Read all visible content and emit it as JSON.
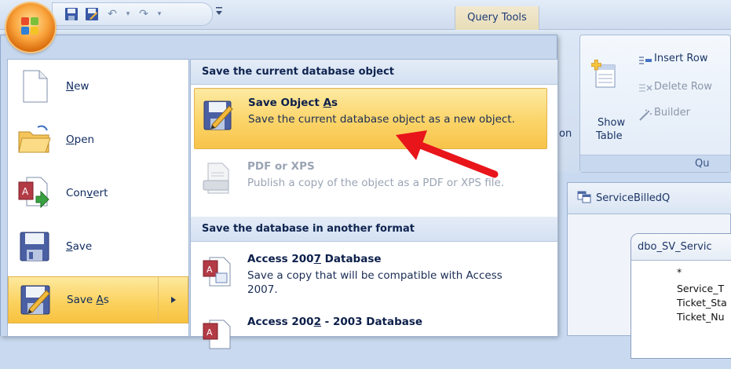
{
  "titlebar": {
    "contextual_tab": "Query Tools",
    "qat_more": "⇤"
  },
  "ribbon": {
    "show_table": [
      "Show",
      "Table"
    ],
    "insert_rows": "Insert Row",
    "delete_rows": "Delete Row",
    "builder": "Builder",
    "group_label": "Qu",
    "partial_text": "on"
  },
  "document": {
    "tab_title": "ServiceBilledQ",
    "field_list_title": "dbo_SV_Servic",
    "fields": [
      "*",
      "Service_T",
      "Ticket_Sta",
      "Ticket_Nu"
    ]
  },
  "menu": {
    "commands": [
      {
        "label": "New",
        "accel": "N",
        "rest": "ew",
        "icon": "new-document-icon"
      },
      {
        "label": "Open",
        "accel": "O",
        "rest": "pen",
        "icon": "open-folder-icon"
      },
      {
        "label": "Convert",
        "pre": "Con",
        "accel": "v",
        "rest": "ert",
        "icon": "convert-icon"
      },
      {
        "label": "Save",
        "accel": "S",
        "rest": "ave",
        "icon": "save-icon"
      },
      {
        "label": "Save As",
        "pre": "Save ",
        "accel": "A",
        "rest": "s",
        "icon": "save-as-icon"
      }
    ],
    "section1_header": "Save the current database object",
    "save_object_as": {
      "pre": "Save Object ",
      "accel": "A",
      "rest": "s",
      "desc": "Save the current database object as a new object."
    },
    "pdf_xps": {
      "title": "PDF or XPS",
      "desc": "Publish a copy of the object as a PDF or XPS file."
    },
    "section2_header": "Save the database in another format",
    "access2007": {
      "pre": "Access 200",
      "accel": "7",
      "rest": " Database",
      "desc": "Save a copy that will be compatible with Access 2007."
    },
    "access2002": {
      "pre": "Access 200",
      "accel": "2",
      "rest": " - 2003 Database"
    }
  },
  "colors": {
    "highlight": "#fbd25f",
    "arrow": "#e8151b",
    "menu_border": "#8fa7cc"
  }
}
